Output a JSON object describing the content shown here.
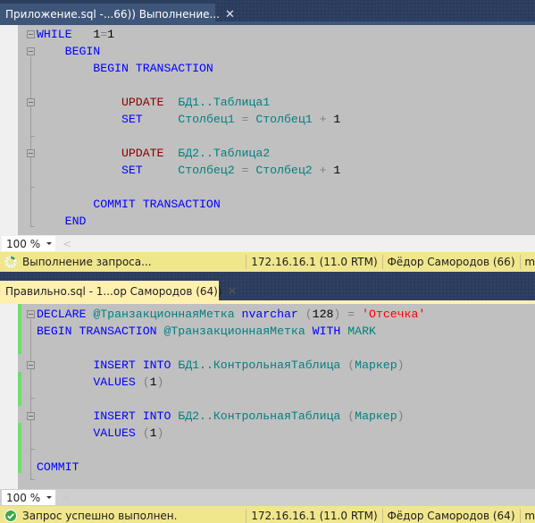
{
  "pane1": {
    "tab": {
      "title": "Приложение.sql -...66)) Выполнение...",
      "close": "✕",
      "active": false
    },
    "code": [
      [
        {
          "t": "WHILE",
          "c": "kw"
        },
        {
          "t": "   ",
          "c": ""
        },
        {
          "t": "1",
          "c": "num"
        },
        {
          "t": "=",
          "c": "op"
        },
        {
          "t": "1",
          "c": "num"
        }
      ],
      [
        {
          "t": "    BEGIN",
          "c": "kw"
        }
      ],
      [
        {
          "t": "        BEGIN TRANSACTION",
          "c": "kw"
        }
      ],
      [
        {
          "t": "",
          "c": ""
        }
      ],
      [
        {
          "t": "            ",
          "c": ""
        },
        {
          "t": "UPDATE",
          "c": "kw2"
        },
        {
          "t": "  ",
          "c": ""
        },
        {
          "t": "БД1..Таблица1",
          "c": "id"
        }
      ],
      [
        {
          "t": "            ",
          "c": ""
        },
        {
          "t": "SET",
          "c": "kw"
        },
        {
          "t": "     ",
          "c": ""
        },
        {
          "t": "Столбец1",
          "c": "id"
        },
        {
          "t": " = ",
          "c": "op"
        },
        {
          "t": "Столбец1",
          "c": "id"
        },
        {
          "t": " + ",
          "c": "op"
        },
        {
          "t": "1",
          "c": "num"
        }
      ],
      [
        {
          "t": "",
          "c": ""
        }
      ],
      [
        {
          "t": "            ",
          "c": ""
        },
        {
          "t": "UPDATE",
          "c": "kw2"
        },
        {
          "t": "  ",
          "c": ""
        },
        {
          "t": "БД2..Таблица2",
          "c": "id"
        }
      ],
      [
        {
          "t": "            ",
          "c": ""
        },
        {
          "t": "SET",
          "c": "kw"
        },
        {
          "t": "     ",
          "c": ""
        },
        {
          "t": "Столбец2",
          "c": "id"
        },
        {
          "t": " = ",
          "c": "op"
        },
        {
          "t": "Столбец2",
          "c": "id"
        },
        {
          "t": " + ",
          "c": "op"
        },
        {
          "t": "1",
          "c": "num"
        }
      ],
      [
        {
          "t": "",
          "c": ""
        }
      ],
      [
        {
          "t": "        COMMIT TRANSACTION",
          "c": "kw"
        }
      ],
      [
        {
          "t": "    END",
          "c": "kw"
        }
      ]
    ],
    "zoom": "100 %",
    "status": {
      "icon": "spinner-icon",
      "text": "Выполнение запроса...",
      "server": "172.16.16.1 (11.0 RTM)",
      "user": "Фёдор Самородов (66)",
      "db": "m"
    }
  },
  "pane2": {
    "tab": {
      "title": "Правильно.sql - 1...ор Самородов (64))",
      "close": "✕",
      "active": true
    },
    "code": [
      [
        {
          "t": "DECLARE",
          "c": "kw"
        },
        {
          "t": " ",
          "c": ""
        },
        {
          "t": "@ТранзакционнаяМетка",
          "c": "id"
        },
        {
          "t": " ",
          "c": ""
        },
        {
          "t": "nvarchar",
          "c": "kw"
        },
        {
          "t": " (",
          "c": "op"
        },
        {
          "t": "128",
          "c": "num"
        },
        {
          "t": ") = ",
          "c": "op"
        },
        {
          "t": "'Отсечка'",
          "c": "str"
        }
      ],
      [
        {
          "t": "BEGIN TRANSACTION",
          "c": "kw"
        },
        {
          "t": " ",
          "c": ""
        },
        {
          "t": "@ТранзакционнаяМетка",
          "c": "id"
        },
        {
          "t": " ",
          "c": ""
        },
        {
          "t": "WITH",
          "c": "kw"
        },
        {
          "t": " ",
          "c": ""
        },
        {
          "t": "MARK",
          "c": "id"
        }
      ],
      [
        {
          "t": "",
          "c": ""
        }
      ],
      [
        {
          "t": "        ",
          "c": ""
        },
        {
          "t": "INSERT INTO",
          "c": "kw"
        },
        {
          "t": " ",
          "c": ""
        },
        {
          "t": "БД1..КонтрольнаяТаблица",
          "c": "id"
        },
        {
          "t": " (",
          "c": "op"
        },
        {
          "t": "Маркер",
          "c": "id"
        },
        {
          "t": ")",
          "c": "op"
        }
      ],
      [
        {
          "t": "        ",
          "c": ""
        },
        {
          "t": "VALUES",
          "c": "kw"
        },
        {
          "t": " (",
          "c": "op"
        },
        {
          "t": "1",
          "c": "num"
        },
        {
          "t": ")",
          "c": "op"
        }
      ],
      [
        {
          "t": "",
          "c": ""
        }
      ],
      [
        {
          "t": "        ",
          "c": ""
        },
        {
          "t": "INSERT INTO",
          "c": "kw"
        },
        {
          "t": " ",
          "c": ""
        },
        {
          "t": "БД2..КонтрольнаяТаблица",
          "c": "id"
        },
        {
          "t": " (",
          "c": "op"
        },
        {
          "t": "Маркер",
          "c": "id"
        },
        {
          "t": ")",
          "c": "op"
        }
      ],
      [
        {
          "t": "        ",
          "c": ""
        },
        {
          "t": "VALUES",
          "c": "kw"
        },
        {
          "t": " (",
          "c": "op"
        },
        {
          "t": "1",
          "c": "num"
        },
        {
          "t": ")",
          "c": "op"
        }
      ],
      [
        {
          "t": "",
          "c": ""
        }
      ],
      [
        {
          "t": "COMMIT",
          "c": "kw"
        }
      ]
    ],
    "zoom": "100 %",
    "status": {
      "icon": "success-check-icon",
      "text": "Запрос успешно выполнен.",
      "server": "172.16.16.1 (11.0 RTM)",
      "user": "Фёдор Самородов (64)",
      "db": "m"
    }
  },
  "colors": {
    "editor_bg": "#c0c0c0",
    "keyword": "#0000ff",
    "dml_keyword": "#8b0000",
    "identifier": "#008080",
    "string": "#ff0000",
    "status_bar": "#f0e68c",
    "change_marker": "#6fdc6f"
  }
}
